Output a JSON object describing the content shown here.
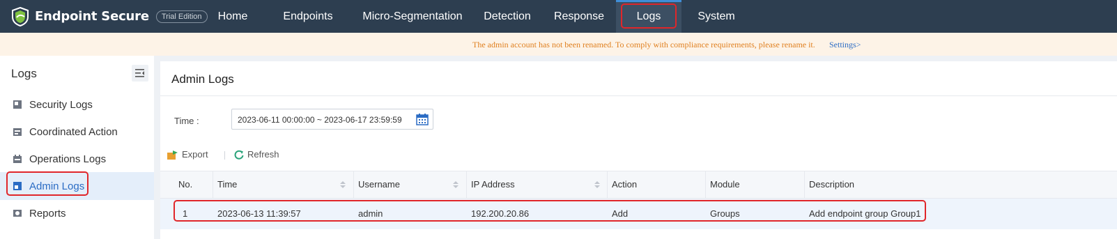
{
  "app": {
    "name": "Endpoint Secure",
    "edition_badge": "Trial Edition"
  },
  "nav": {
    "items": [
      {
        "label": "Home"
      },
      {
        "label": "Endpoints"
      },
      {
        "label": "Micro-Segmentation"
      },
      {
        "label": "Detection"
      },
      {
        "label": "Response"
      },
      {
        "label": "Logs"
      },
      {
        "label": "System"
      }
    ],
    "active": "Logs"
  },
  "banner": {
    "message": "The admin account has not been renamed. To comply with compliance requirements, please rename it.",
    "link": "Settings>"
  },
  "sidebar": {
    "title": "Logs",
    "items": [
      {
        "label": "Security Logs",
        "icon": "security-logs-icon"
      },
      {
        "label": "Coordinated Action",
        "icon": "coordinated-action-icon"
      },
      {
        "label": "Operations Logs",
        "icon": "operations-logs-icon"
      },
      {
        "label": "Admin Logs",
        "icon": "admin-logs-icon"
      },
      {
        "label": "Reports",
        "icon": "reports-icon"
      }
    ],
    "active": "Admin Logs"
  },
  "main": {
    "title": "Admin Logs",
    "filter": {
      "time_label": "Time :",
      "time_value": "2023-06-11 00:00:00 ~ 2023-06-17 23:59:59"
    },
    "toolbar": {
      "export_label": "Export",
      "refresh_label": "Refresh"
    },
    "table": {
      "columns": [
        "No.",
        "Time",
        "Username",
        "IP Address",
        "Action",
        "Module",
        "Description"
      ],
      "rows": [
        {
          "no": "1",
          "time": "2023-06-13 11:39:57",
          "username": "admin",
          "ip": "192.200.20.86",
          "action": "Add",
          "module": "Groups",
          "description": "Add endpoint group Group1"
        }
      ]
    }
  },
  "colors": {
    "topbar": "#2d3e50",
    "accent": "#2b6cc4",
    "warning_text": "#e08020",
    "highlight": "#e0262a"
  }
}
